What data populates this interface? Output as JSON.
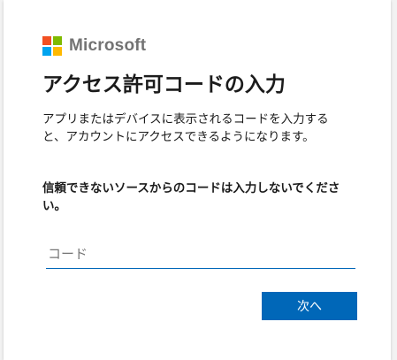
{
  "brand": {
    "name": "Microsoft",
    "logo_colors": [
      "#f25022",
      "#7fba00",
      "#00a4ef",
      "#ffb900"
    ]
  },
  "page": {
    "title": "アクセス許可コードの入力",
    "description": "アプリまたはデバイスに表示されるコードを入力すると、アカウントにアクセスできるようになります。",
    "warning": "信頼できないソースからのコードは入力しないでください。"
  },
  "form": {
    "code_placeholder": "コード",
    "code_value": "",
    "next_label": "次へ"
  },
  "colors": {
    "accent": "#0067b8"
  }
}
